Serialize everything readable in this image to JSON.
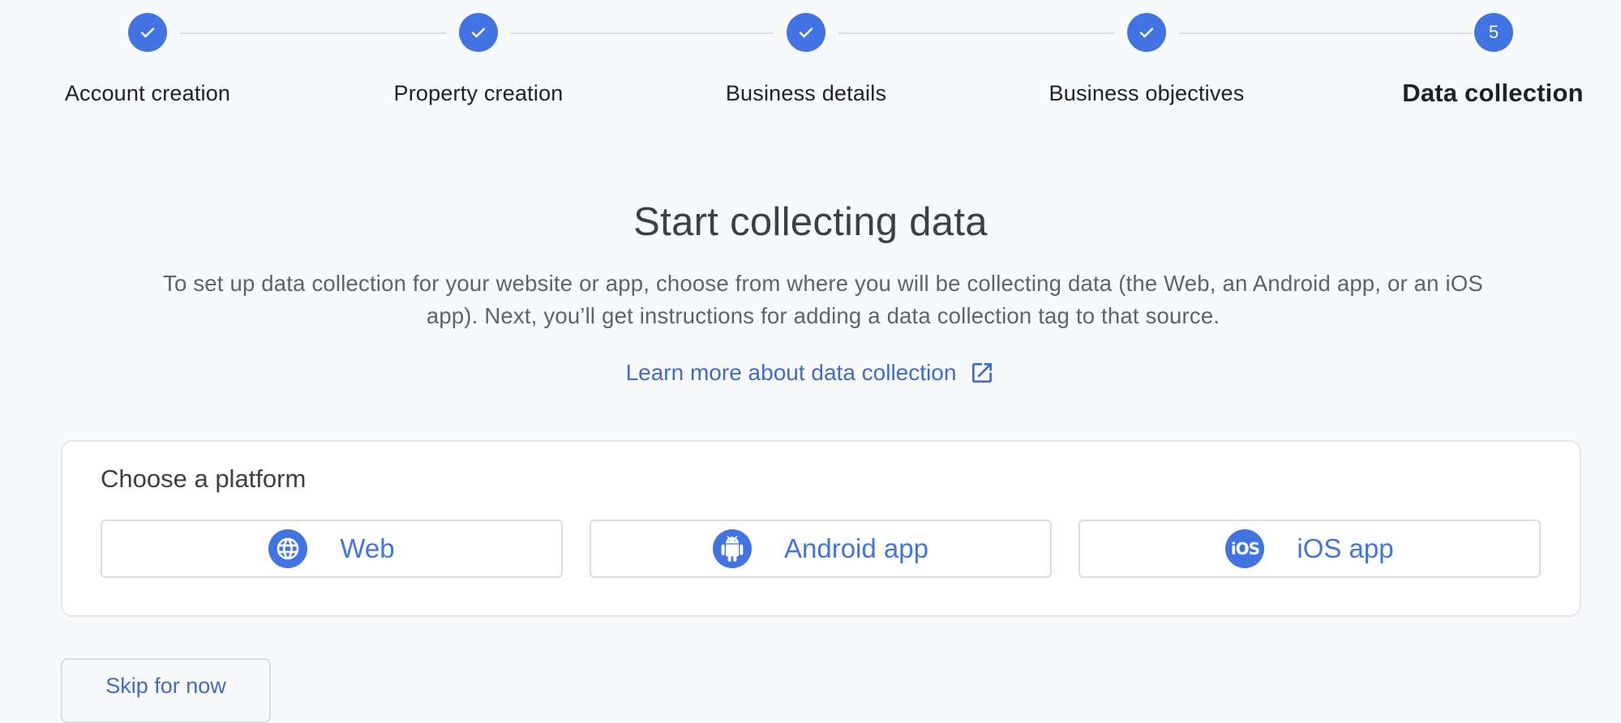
{
  "stepper": {
    "steps": [
      {
        "label": "Account creation",
        "status": "completed",
        "icon": "check-icon"
      },
      {
        "label": "Property creation",
        "status": "completed",
        "icon": "check-icon"
      },
      {
        "label": "Business details",
        "status": "completed",
        "icon": "check-icon"
      },
      {
        "label": "Business objectives",
        "status": "completed",
        "icon": "check-icon"
      },
      {
        "label": "Data collection",
        "status": "active",
        "number": "5"
      }
    ]
  },
  "main": {
    "title": "Start collecting data",
    "description": "To set up data collection for your website or app, choose from where you will be collecting data (the Web, an Android app, or an iOS app). Next, you’ll get instructions for adding a data collection tag to that source.",
    "learn_more_link": "Learn more about data collection",
    "learn_more_icon": "open-in-new-icon"
  },
  "platform_card": {
    "title": "Choose a platform",
    "buttons": [
      {
        "label": "Web",
        "icon": "globe-icon"
      },
      {
        "label": "Android app",
        "icon": "android-icon"
      },
      {
        "label": "iOS app",
        "icon": "ios-icon",
        "icon_text": "iOS"
      }
    ]
  },
  "footer": {
    "skip_label": "Skip for now"
  },
  "colors": {
    "accent": "#4273e3",
    "link": "#3f6bc9",
    "background": "#f8f9fb",
    "border": "#dadce0"
  }
}
